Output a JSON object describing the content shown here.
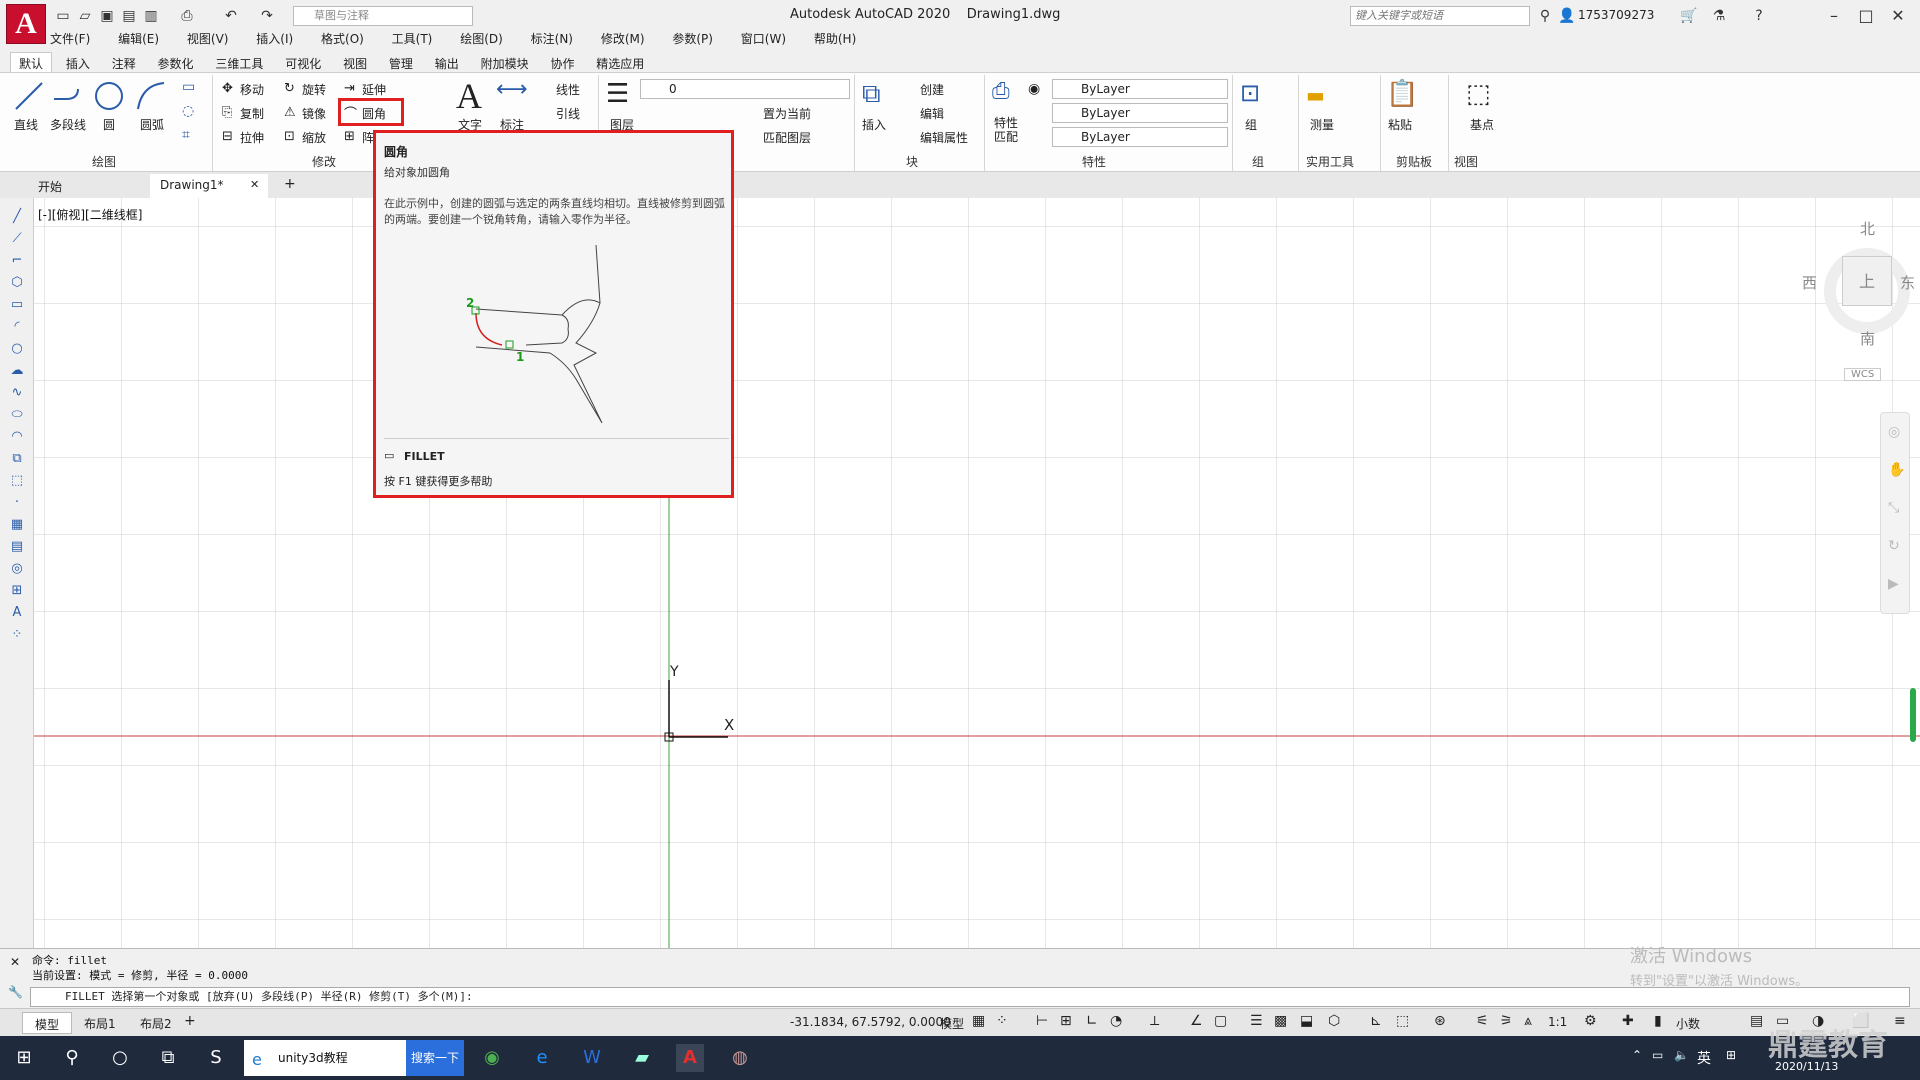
{
  "titlebar": {
    "app_name": "Autodesk AutoCAD 2020",
    "file_name": "Drawing1.dwg",
    "workspace": "草图与注释",
    "search_placeholder": "键入关键字或短语",
    "user": "1753709273",
    "logo_letter": "A"
  },
  "menu": [
    "文件(F)",
    "编辑(E)",
    "视图(V)",
    "插入(I)",
    "格式(O)",
    "工具(T)",
    "绘图(D)",
    "标注(N)",
    "修改(M)",
    "参数(P)",
    "窗口(W)",
    "帮助(H)"
  ],
  "ribbon_tabs": [
    "默认",
    "插入",
    "注释",
    "参数化",
    "三维工具",
    "可视化",
    "视图",
    "管理",
    "输出",
    "附加模块",
    "协作",
    "精选应用"
  ],
  "ribbon": {
    "draw": {
      "line": "直线",
      "polyline": "多段线",
      "circle": "圆",
      "arc": "圆弧",
      "label": "绘图"
    },
    "modify": {
      "move": "移动",
      "rotate": "旋转",
      "trim": "延伸",
      "copy": "复制",
      "mirror": "镜像",
      "fillet": "圆角",
      "stretch": "拉伸",
      "scale": "缩放",
      "array": "阵",
      "label": "修改"
    },
    "annotation": {
      "text": "文字",
      "dimension": "标注",
      "linear": "线性",
      "leader": "引线"
    },
    "layers": {
      "layer": "图层",
      "current_layer": "0",
      "set_current": "置为当前",
      "match_layer": "匹配图层"
    },
    "block": {
      "insert": "插入",
      "create": "创建",
      "edit": "编辑",
      "edit_attr": "编辑属性",
      "label": "块"
    },
    "properties": {
      "match": "特性\n匹配",
      "color": "ByLayer",
      "linetype": "ByLayer",
      "lineweight": "ByLayer",
      "label": "特性"
    },
    "groups": {
      "group": "组",
      "label": "组"
    },
    "utilities": {
      "measure": "测量",
      "label": "实用工具"
    },
    "clipboard": {
      "paste": "粘贴",
      "label": "剪贴板"
    },
    "view": {
      "base": "基点",
      "label": "视图"
    }
  },
  "doc_tabs": [
    "开始",
    "Drawing1*"
  ],
  "view_label": "[-][俯视][二维线框]",
  "tooltip": {
    "title": "圆角",
    "subtitle": "给对象加圆角",
    "description": "在此示例中，创建的圆弧与选定的两条直线均相切。直线被修剪到圆弧的两端。要创建一个锐角转角，请输入零作为半径。",
    "command": "FILLET",
    "help": "按 F1 键获得更多帮助",
    "pt1": "1",
    "pt2": "2"
  },
  "viewcube": {
    "north": "北",
    "south": "南",
    "east": "东",
    "west": "西",
    "face": "上",
    "wcs": "WCS"
  },
  "ucs": {
    "x": "X",
    "y": "Y"
  },
  "command": {
    "line1": "命令:  fillet",
    "line2": "当前设置: 模式 = 修剪, 半径 = 0.0000",
    "prompt": "FILLET 选择第一个对象或 [放弃(U) 多段线(P) 半径(R) 修剪(T) 多个(M)]:"
  },
  "layout_tabs": [
    "模型",
    "布局1",
    "布局2"
  ],
  "status": {
    "coords": "-31.1834, 67.5792, 0.0000",
    "model": "模型",
    "scale": "1:1",
    "units": "小数"
  },
  "watermark": {
    "line1": "激活 Windows",
    "line2": "转到\"设置\"以激活 Windows。"
  },
  "taskbar": {
    "search_text": "unity3d教程",
    "search_button": "搜索一下",
    "lang": "英",
    "date": "2020/11/13"
  },
  "brand": "鼎霆教育",
  "colors": {
    "accent_red": "#e02020",
    "taskbar": "#1f2a3c",
    "autocad_red": "#c8102e"
  }
}
